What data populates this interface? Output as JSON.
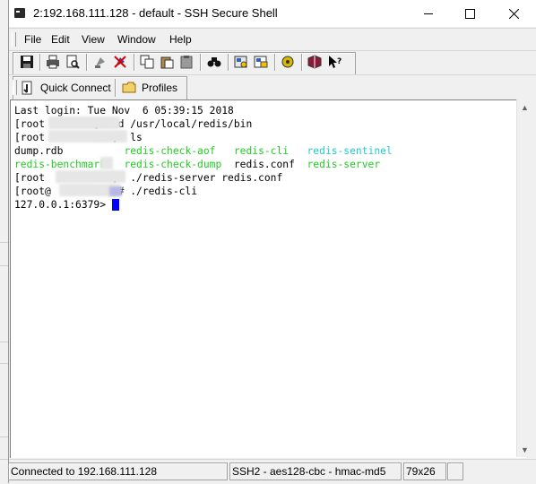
{
  "window": {
    "title": "2:192.168.111.128 - default - SSH Secure Shell",
    "controls": [
      "minimize",
      "maximize",
      "close"
    ]
  },
  "menu": {
    "items": [
      "File",
      "Edit",
      "View",
      "Window",
      "Help"
    ]
  },
  "toolbar": {
    "icons": [
      "save-icon",
      "print-icon",
      "print-preview-icon",
      "disconnect-icon",
      "disconnect-red-icon",
      "copy-icon",
      "paste-icon",
      "clipboard-icon",
      "find-icon",
      "settings-icon",
      "profiles-icon",
      "key-icon",
      "book-icon",
      "help-pointer-icon"
    ]
  },
  "quickbar": {
    "quick_connect": "Quick Connect",
    "profiles": "Profiles"
  },
  "terminal": {
    "lines": [
      [
        {
          "t": "Last login: Tue Nov  6 05:39:15 2018",
          "c": "default"
        }
      ],
      [
        {
          "t": "[root       ~]# cd /usr/local/redis/bin",
          "c": "default"
        }
      ],
      [
        {
          "t": "[root        bin]# ls",
          "c": "default"
        }
      ],
      [
        {
          "t": "dump.rdb          ",
          "c": "default"
        },
        {
          "t": "redis-check-aof   ",
          "c": "green"
        },
        {
          "t": "redis-cli   ",
          "c": "green"
        },
        {
          "t": "redis-sentinel",
          "c": "cyan"
        }
      ],
      [
        {
          "t": "redis-benchmark   ",
          "c": "green"
        },
        {
          "t": "redis-check-dump  ",
          "c": "green"
        },
        {
          "t": "redis.conf  ",
          "c": "default"
        },
        {
          "t": "redis-server",
          "c": "green"
        }
      ],
      [
        {
          "t": "[root        bin]# ./redis-server redis.conf",
          "c": "default"
        }
      ],
      [
        {
          "t": "[root@       bin]# ./redis-cli",
          "c": "default"
        }
      ],
      [
        {
          "t": "127.0.0.1:6379> ",
          "c": "default"
        }
      ]
    ]
  },
  "status": {
    "connection": "Connected to 192.168.111.128",
    "cipher": "SSH2 - aes128-cbc - hmac-md5",
    "size": "79x26"
  },
  "colors": {
    "terminal_bg": "#ffffff",
    "green": "#22cc22",
    "cyan": "#22cccc",
    "cursor": "#0000ff"
  }
}
